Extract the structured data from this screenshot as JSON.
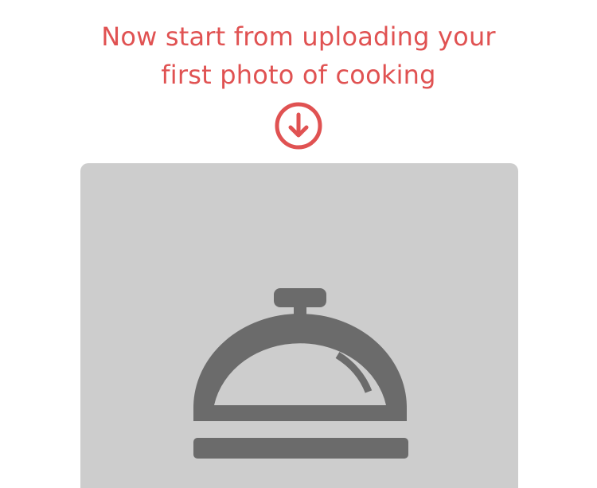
{
  "prompt": {
    "line1": "Now start from uploading your",
    "line2": "first photo of cooking"
  },
  "icons": {
    "arrow": "arrow-down-circle-icon",
    "placeholder": "food-cloche-icon"
  },
  "colors": {
    "accent": "#e05252",
    "placeholder_bg": "#cdcdcd",
    "icon": "#6b6b6b"
  }
}
